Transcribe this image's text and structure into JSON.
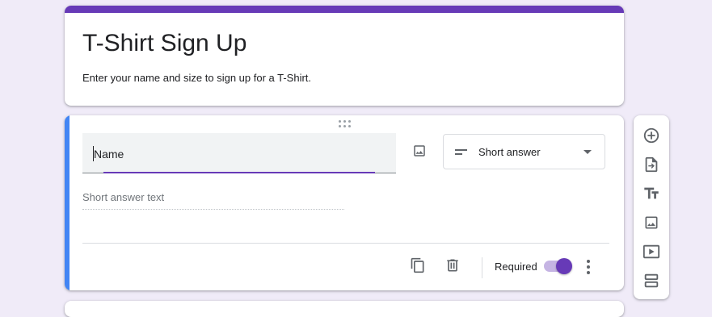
{
  "form": {
    "title": "T-Shirt Sign Up",
    "description": "Enter your name and size to sign up for a T-Shirt."
  },
  "question": {
    "title": "Name",
    "type_selected": "Short answer",
    "answer_placeholder": "Short answer text",
    "required_label": "Required",
    "required": true
  },
  "icons": {
    "drag": "drag-handle-icon",
    "image": "image-icon",
    "type": "short-text-icon",
    "dropdown": "dropdown-arrow-icon",
    "duplicate": "copy-icon",
    "delete": "trash-icon",
    "more": "more-vert-icon"
  },
  "toolbar": [
    {
      "icon": "add-circle-icon"
    },
    {
      "icon": "import-icon"
    },
    {
      "icon": "title-icon"
    },
    {
      "icon": "image-icon"
    },
    {
      "icon": "video-icon"
    },
    {
      "icon": "section-icon"
    }
  ],
  "colors": {
    "theme": "#673ab7",
    "active_accent": "#4285f4",
    "background": "#f0ebf8"
  }
}
